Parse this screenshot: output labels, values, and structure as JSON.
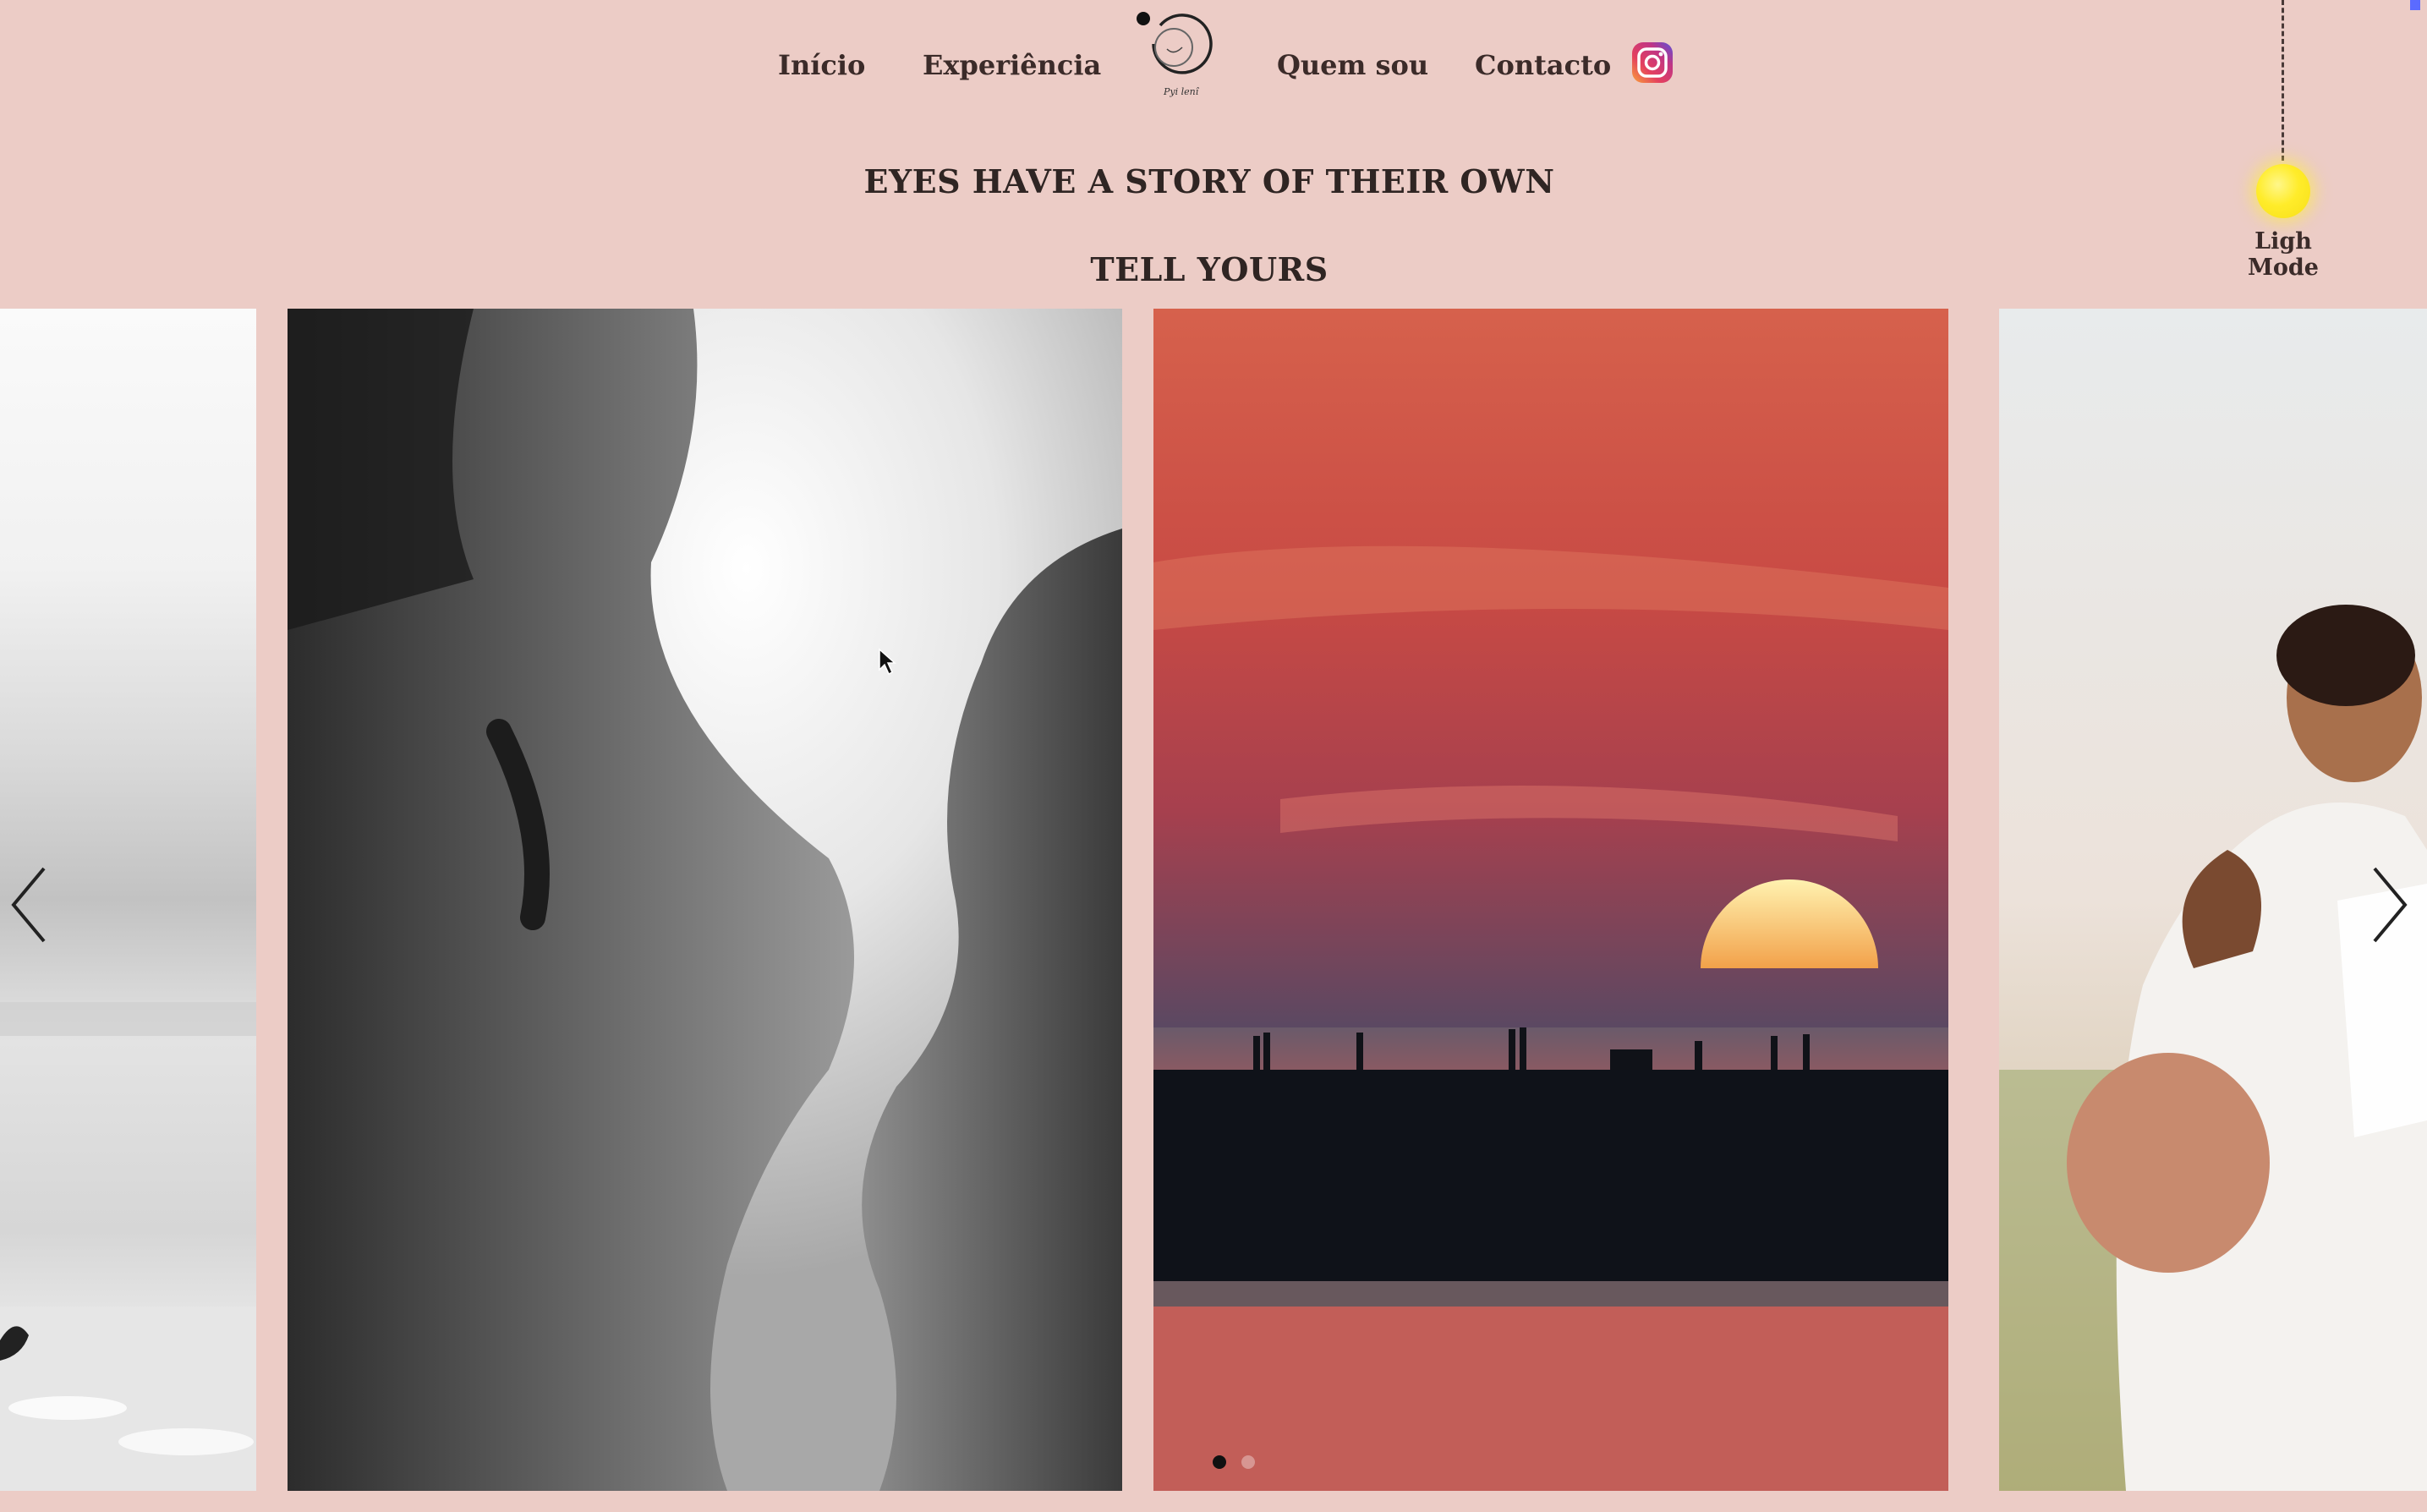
{
  "nav": {
    "items": [
      {
        "label": "Início"
      },
      {
        "label": "Experiência"
      },
      {
        "label": "Quem sou"
      },
      {
        "label": "Contacto"
      }
    ],
    "logo_caption": "Pyi lenî",
    "instagram_icon": "instagram-icon"
  },
  "hero": {
    "line1": "EYES HAVE A STORY OF THEIR OWN",
    "line2": "TELL YOURS"
  },
  "theme_toggle": {
    "label": "Ligh Mode",
    "bulb_color": "#ffec2a"
  },
  "slider": {
    "slides": [
      {
        "name": "beach-bw"
      },
      {
        "name": "pregnancy-silhouette-bw"
      },
      {
        "name": "sunset-pier"
      },
      {
        "name": "couple-embrace"
      }
    ],
    "active_dot": 1,
    "dot_count": 2
  },
  "colors": {
    "page_background": "#ecccc6",
    "text": "#3b2b29"
  }
}
